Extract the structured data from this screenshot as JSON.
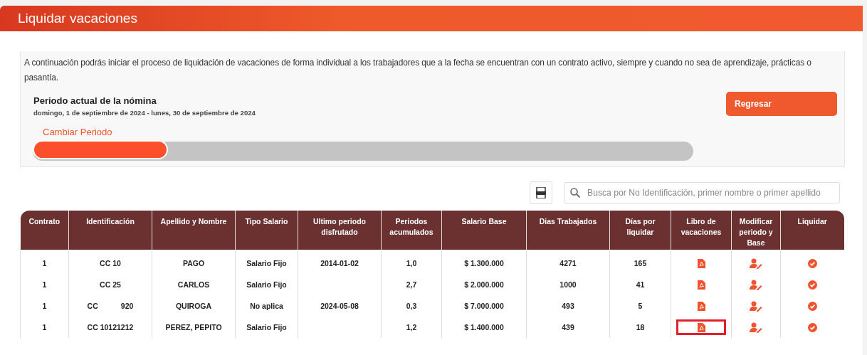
{
  "header": {
    "title": "Liquidar vacaciones"
  },
  "intro": "A continuación podrás iniciar el proceso de liquidación de vacaciones de forma individual a los trabajadores que a la fecha se encuentran con un contrato activo, siempre y cuando no sea de aprendizaje, prácticas o pasantía.",
  "period": {
    "title": "Periodo actual de la nómina",
    "range": "domingo, 1 de septiembre de 2024 - lunes, 30 de septiembre de 2024",
    "change_link": "Cambiar Periodo",
    "level": 0.2
  },
  "back_button": "Regresar",
  "search": {
    "placeholder": "Busca por No Identificación, primer nombre o primer apellido"
  },
  "table": {
    "columns": [
      "Contrato",
      "Identificación",
      "Apellido y Nombre",
      "Tipo Salario",
      "Ultimo periodo disfrutado",
      "Periodos acumulados",
      "Salario Base",
      "Dias Trabajados",
      "Días por liquidar",
      "Libro de vacaciones",
      "Modificar periodo y Base",
      "Liquidar"
    ],
    "rows": [
      {
        "contrato": "1",
        "identificacion": "CC 10",
        "nombre": "PAGO",
        "tipo_salario": "Salario Fijo",
        "ultimo_periodo": "2014-01-02",
        "periodos": "1,0",
        "salario_base": "$ 1.300.000",
        "dias_trabajados": "4271",
        "dias_por_liquidar": "165",
        "highlighted": false
      },
      {
        "contrato": "1",
        "identificacion": "CC 25",
        "nombre": "CARLOS",
        "tipo_salario": "Salario Fijo",
        "ultimo_periodo": "",
        "periodos": "2,7",
        "salario_base": "$ 2.000.000",
        "dias_trabajados": "1000",
        "dias_por_liquidar": "41",
        "highlighted": false
      },
      {
        "contrato": "1",
        "identificacion": "CC           920",
        "nombre": "QUIROGA",
        "tipo_salario": "No aplica",
        "ultimo_periodo": "2024-05-08",
        "periodos": "0,3",
        "salario_base": "$ 7.000.000",
        "dias_trabajados": "493",
        "dias_por_liquidar": "5",
        "highlighted": false
      },
      {
        "contrato": "1",
        "identificacion": "CC 10121212",
        "nombre": "PEREZ, PEPITO",
        "tipo_salario": "Salario Fijo",
        "ultimo_periodo": "",
        "periodos": "1,2",
        "salario_base": "$ 1.400.000",
        "dias_trabajados": "439",
        "dias_por_liquidar": "18",
        "highlighted": true
      }
    ]
  }
}
